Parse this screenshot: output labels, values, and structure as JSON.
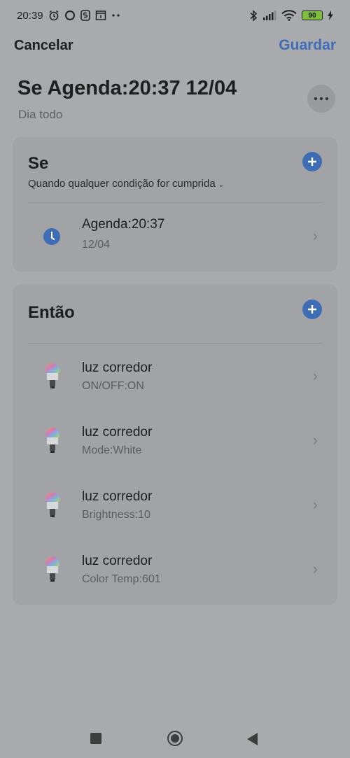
{
  "status_bar": {
    "time": "20:39",
    "left_icons": [
      "alarm-icon",
      "circle-notification-icon",
      "app-s-icon",
      "calendar-icon",
      "more-notifications-icon"
    ],
    "right_icons": [
      "bluetooth-icon",
      "signal-icon",
      "wifi-icon"
    ],
    "battery": "90"
  },
  "topbar": {
    "cancel_label": "Cancelar",
    "save_label": "Guardar"
  },
  "header": {
    "title": "Se Agenda:20:37 12/04",
    "subtitle": "Dia todo",
    "more_icon": "ellipsis-icon"
  },
  "if_section": {
    "title": "Se",
    "condition_mode": "Quando qualquer condição for cumprida",
    "items": [
      {
        "title": "Agenda:20:37",
        "subtitle": "12/04",
        "icon": "clock-icon"
      }
    ]
  },
  "then_section": {
    "title": "Então",
    "items": [
      {
        "title": "luz corredor",
        "subtitle": "ON/OFF:ON",
        "icon": "bulb-icon"
      },
      {
        "title": "luz corredor",
        "subtitle": "Mode:White",
        "icon": "bulb-icon"
      },
      {
        "title": "luz corredor",
        "subtitle": "Brightness:10",
        "icon": "bulb-icon"
      },
      {
        "title": "luz corredor",
        "subtitle": "Color Temp:601",
        "icon": "bulb-icon"
      }
    ]
  },
  "navbar": {
    "icons": [
      "recent-apps-icon",
      "home-icon",
      "back-icon"
    ]
  },
  "colors": {
    "accent": "#3e6db6",
    "background": "#a9aaae",
    "card": "#a2a3a7"
  }
}
